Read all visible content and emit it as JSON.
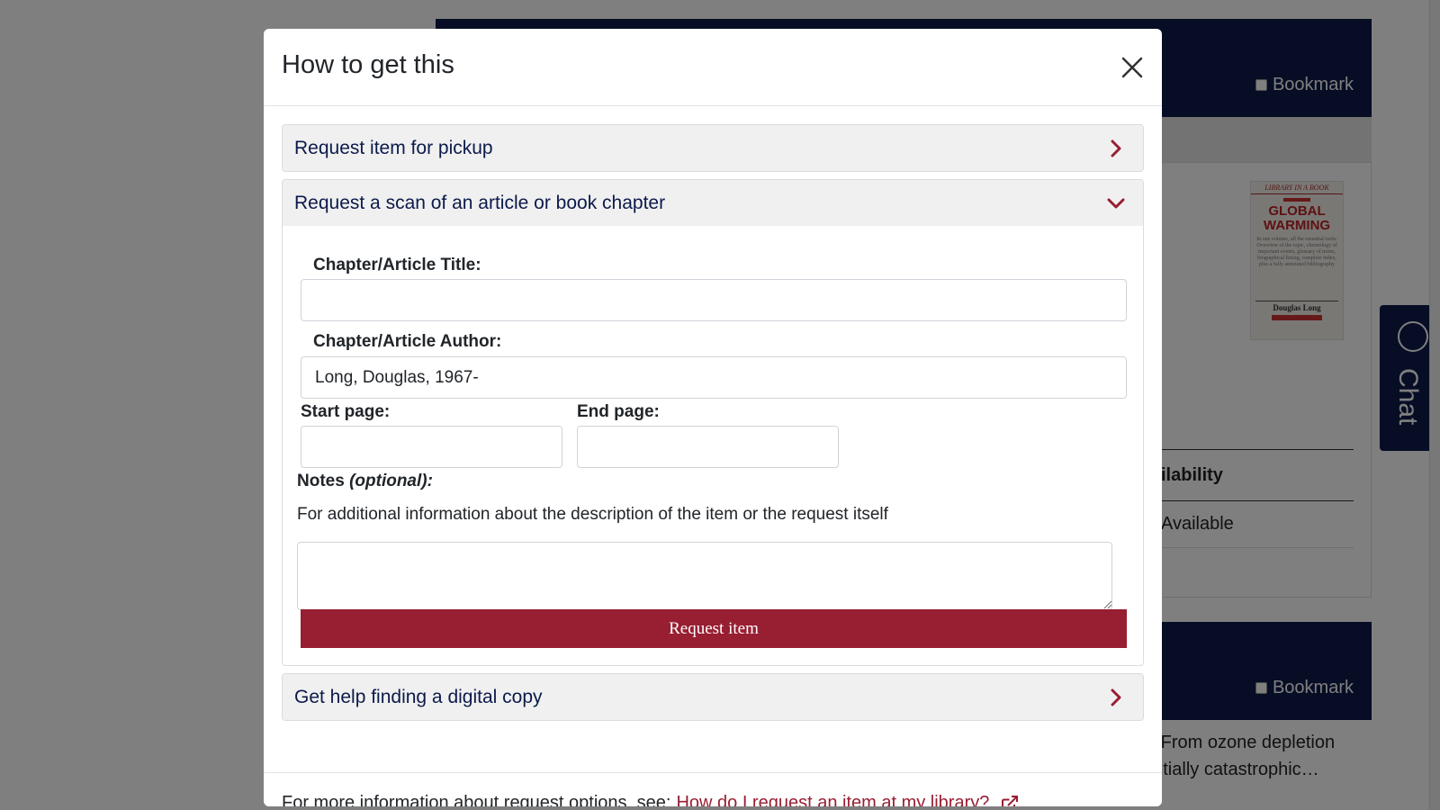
{
  "background": {
    "bookmark_label": "Bookmark",
    "cover": {
      "series": "LIBRARY IN A BOOK",
      "title": "GLOBAL WARMING",
      "blurb": "In one volume, all the essential tools: Overview of the topic, chronology of important events, glossary of terms, biographical listing, complete index, plus a fully annotated bibliography",
      "author": "Douglas Long"
    },
    "availability_heading": "ilability",
    "availability_value": "Available",
    "description_snippet": "y. From ozone depletion entially catastrophic…",
    "chat_label": "Chat"
  },
  "modal": {
    "title": "How to get this",
    "sections": [
      {
        "label": "Request item for pickup",
        "expanded": false
      },
      {
        "label": "Request a scan of an article or book chapter",
        "expanded": true
      },
      {
        "label": "Get help finding a digital copy",
        "expanded": false
      }
    ],
    "scan_form": {
      "title_label": "Chapter/Article Title:",
      "title_value": "",
      "author_label": "Chapter/Article Author:",
      "author_value": "Long, Douglas, 1967-",
      "start_label": "Start page:",
      "start_value": "",
      "end_label": "End page:",
      "end_value": "",
      "notes_label": "Notes ",
      "notes_optional": "(optional):",
      "notes_help": "For additional information about the description of the item or the request itself",
      "notes_value": "",
      "submit_label": "Request item"
    },
    "footer": {
      "text": "For more information about request options, see:",
      "link_text": "How do I request an item at my library?"
    }
  },
  "colors": {
    "navy": "#0c1a4b",
    "maroon": "#981e32",
    "overlay": "rgba(0,0,0,0.5)"
  },
  "icons": {
    "close": "close-icon",
    "expand": "chevron-right-icon",
    "collapse": "chevron-down-icon",
    "external": "external-link-icon",
    "chat": "chat-bubble-icon"
  }
}
